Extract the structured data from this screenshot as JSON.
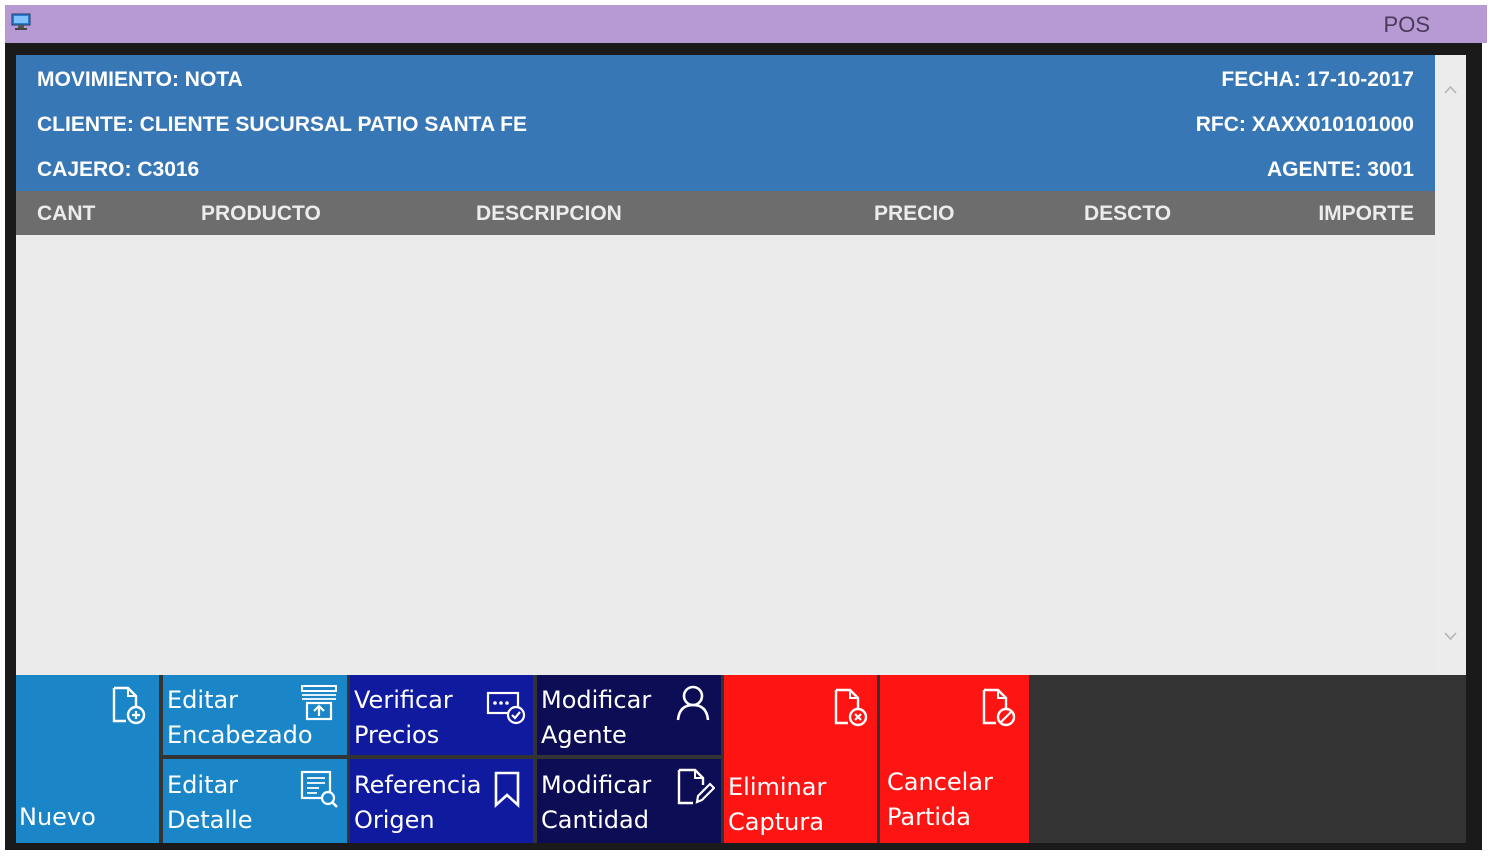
{
  "window": {
    "title": "POS"
  },
  "header": {
    "movimiento": "MOVIMIENTO: NOTA",
    "cliente": "CLIENTE: CLIENTE SUCURSAL PATIO SANTA FE",
    "cajero": "CAJERO: C3016",
    "fecha": "FECHA: 17-10-2017",
    "rfc": "RFC: XAXX010101000",
    "agente": "AGENTE: 3001"
  },
  "table": {
    "columns": [
      "CANT",
      "PRODUCTO",
      "DESCRIPCION",
      "PRECIO",
      "DESCTO",
      "IMPORTE"
    ],
    "rows": []
  },
  "toolbar": {
    "nuevo": {
      "label": "Nuevo",
      "icon": "document-add-icon"
    },
    "editar_encabezado": {
      "line1": "Editar",
      "line2": "Encabezado",
      "icon": "edit-header-icon"
    },
    "editar_detalle": {
      "line1": "Editar",
      "line2": "Detalle",
      "icon": "document-search-icon"
    },
    "verificar_precios": {
      "line1": "Verificar",
      "line2": "Precios",
      "icon": "price-check-icon"
    },
    "referencia_origen": {
      "line1": "Referencia",
      "line2": "Origen",
      "icon": "bookmark-icon"
    },
    "modificar_agente": {
      "line1": "Modificar",
      "line2": "Agente",
      "icon": "person-icon"
    },
    "modificar_cantidad": {
      "line1": "Modificar",
      "line2": "Cantidad",
      "icon": "document-edit-icon"
    },
    "eliminar_captura": {
      "line1": "Eliminar",
      "line2": "Captura",
      "icon": "document-delete-icon"
    },
    "cancelar_partida": {
      "line1": "Cancelar",
      "line2": "Partida",
      "icon": "document-block-icon"
    }
  },
  "colors": {
    "title_bar": "#b79ad3",
    "header_blue": "#3877b5",
    "column_header": "#6d6d6d",
    "button_blue": "#1a86c8",
    "button_navy": "#0f1a9e",
    "button_dark_navy": "#0c0d55",
    "button_red": "#ff1414"
  }
}
